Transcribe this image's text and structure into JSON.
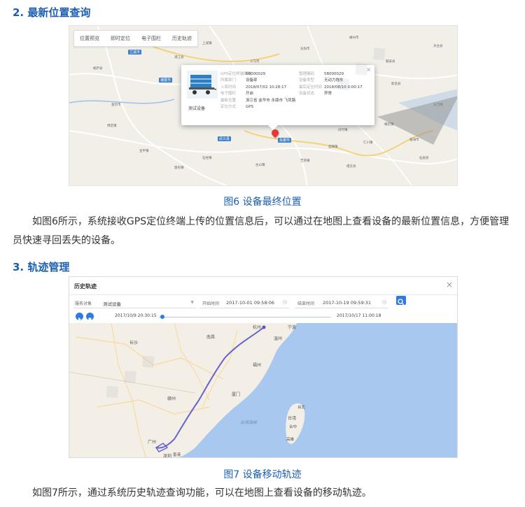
{
  "section2": {
    "title": "2. 最新位置查询"
  },
  "fig6": {
    "caption": "图6 设备最终位置",
    "tabs": [
      "位置预览",
      "即时定位",
      "电子围栏",
      "历史轨迹"
    ],
    "popup": {
      "close": "×",
      "device_name": "测试设备",
      "left_fields": [
        {
          "k": "GPS定位终端编码",
          "v": "58000029"
        },
        {
          "k": "所属部门",
          "v": "设备部"
        },
        {
          "k": "入库时间",
          "v": "2018/07/02 10:28:17"
        },
        {
          "k": "电子围栏",
          "v": "开启"
        },
        {
          "k": "最新位置",
          "v": "浙江省 金华市 永康市 飞凤路"
        },
        {
          "k": "定位方式",
          "v": "GPS"
        }
      ],
      "right_fields": [
        {
          "k": "管理编码",
          "v": "58000029"
        },
        {
          "k": "设备类型",
          "v": "无动力拖车"
        },
        {
          "k": "最后定位时间",
          "v": "2018/08/10 0:00:17"
        },
        {
          "k": "设备状态",
          "v": "异常"
        }
      ]
    },
    "cities": [
      "兰溪市",
      "诸暨市",
      "武义县",
      "永康市"
    ],
    "towns": [
      "桐庐县",
      "浦江县",
      "义乌市",
      "东阳市",
      "磐安县",
      "缙云县",
      "仙居县",
      "天台县",
      "嵊州市",
      "新昌县",
      "金华市",
      "上溪镇",
      "佛堂镇",
      "横店镇",
      "古山镇",
      "芝英镇",
      "唐先镇",
      "壶镇镇",
      "白竹镇",
      "石柱镇",
      "仁川镇",
      "三门湾",
      "临海市",
      "宣平镇"
    ]
  },
  "para6": "如图6所示，系统接收GPS定位终端上传的位置信息后，可以通过在地图上查看设备的最新位置信息，方便管理员快速寻回丢失的设备。",
  "section3": {
    "title": "3. 轨迹管理"
  },
  "fig7": {
    "caption": "图7 设备移动轨迹",
    "title": "历史轨迹",
    "close": "×",
    "filter": {
      "object_label": "服务对象",
      "object_value": "测试设备",
      "start_label": "开始时间",
      "start_value": "2017-10-01 09:58:06",
      "end_label": "结束时间",
      "end_value": "2017-10-19 09:59:31"
    },
    "playback": {
      "current": "2017/10/9 20:30:15",
      "end": "2017/10/17 11:00:18",
      "progress": 0.02
    },
    "places": [
      "南昌",
      "长沙",
      "赣州",
      "福州",
      "厦门",
      "深圳",
      "广州",
      "香港",
      "台湾",
      "台北",
      "台中",
      "高雄",
      "台湾海峡",
      "温州",
      "宁波",
      "杭州"
    ]
  },
  "para7": "如图7所示，通过系统历史轨迹查询功能，可以在地图上查看设备的移动轨迹。",
  "colors": {
    "accent": "#1c5fb2",
    "button": "#2f7be0",
    "sea": "#a8c8ef",
    "land": "#f3efe6",
    "track": "#5a54c8"
  }
}
